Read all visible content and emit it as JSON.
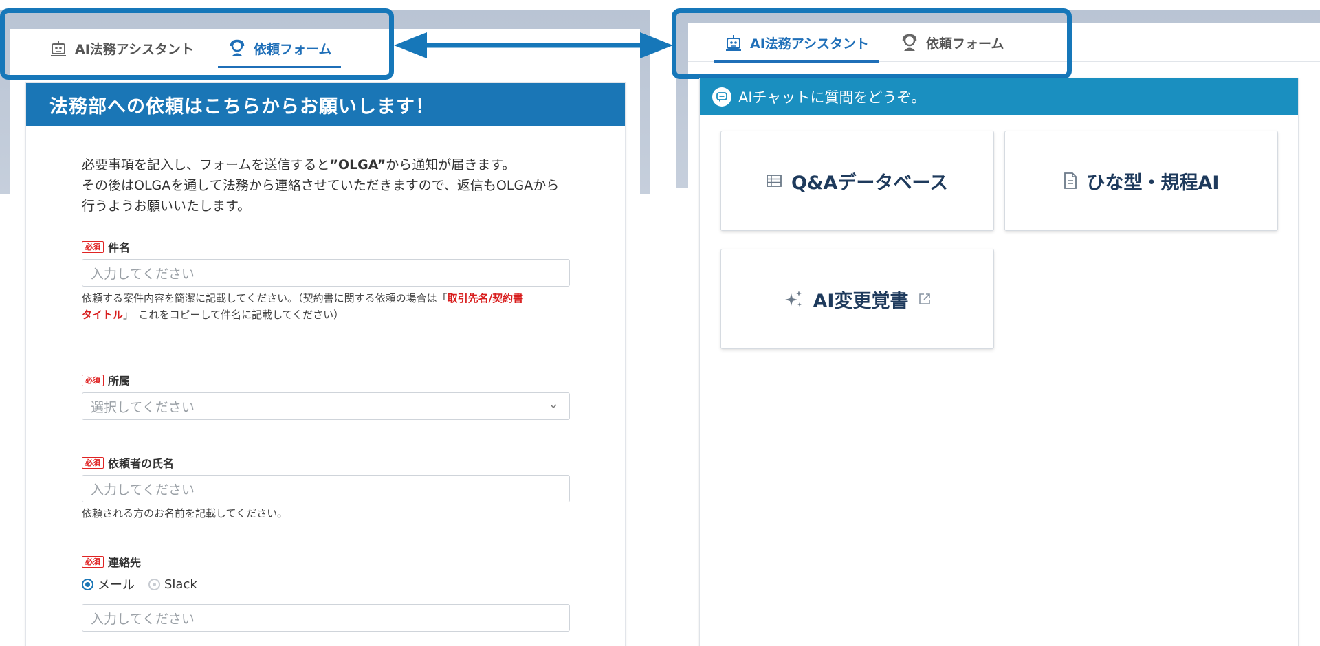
{
  "tabs": {
    "ai_assistant": "AI法務アシスタント",
    "request_form": "依頼フォーム"
  },
  "form": {
    "header": "法務部への依頼はこちらからお願いします！",
    "intro_line1_a": "必要事項を記入し、フォームを送信すると",
    "intro_line1_b": "”OLGA”",
    "intro_line1_c": "から通知が届きます。",
    "intro_line2": "その後はOLGAを通して法務から連絡させていただきますので、返信もOLGAから",
    "intro_line3": "行うようお願いいたします。",
    "required_badge": "必須",
    "subject": {
      "label": "件名",
      "placeholder": "入力してください",
      "hint_a": "依頼する案件内容を簡潔に記載してください。（契約書に関する依頼の場合は「",
      "hint_red1": "取引先名/契約書",
      "hint_red2": "タイトル",
      "hint_b": "」　これをコピーして件名に記載してください）"
    },
    "department": {
      "label": "所属",
      "placeholder": "選択してください"
    },
    "requester": {
      "label": "依頼者の氏名",
      "placeholder": "入力してください",
      "hint": "依頼される方のお名前を記載してください。"
    },
    "contact": {
      "label": "連絡先",
      "option_mail": "メール",
      "option_slack": "Slack",
      "selected": "メール",
      "placeholder": "入力してください"
    }
  },
  "chat": {
    "header": "AIチャットに質問をどうぞ。",
    "tiles": [
      {
        "label": "Q&Aデータベース",
        "icon": "list-icon"
      },
      {
        "label": "ひな型・規程AI",
        "icon": "document-icon"
      },
      {
        "label": "AI変更覚書",
        "icon": "sparkle-icon",
        "external": true
      }
    ]
  },
  "colors": {
    "accent": "#1a76b6",
    "highlight": "#1677b9",
    "chat_header": "#1a8fc0",
    "required": "#e02424"
  }
}
